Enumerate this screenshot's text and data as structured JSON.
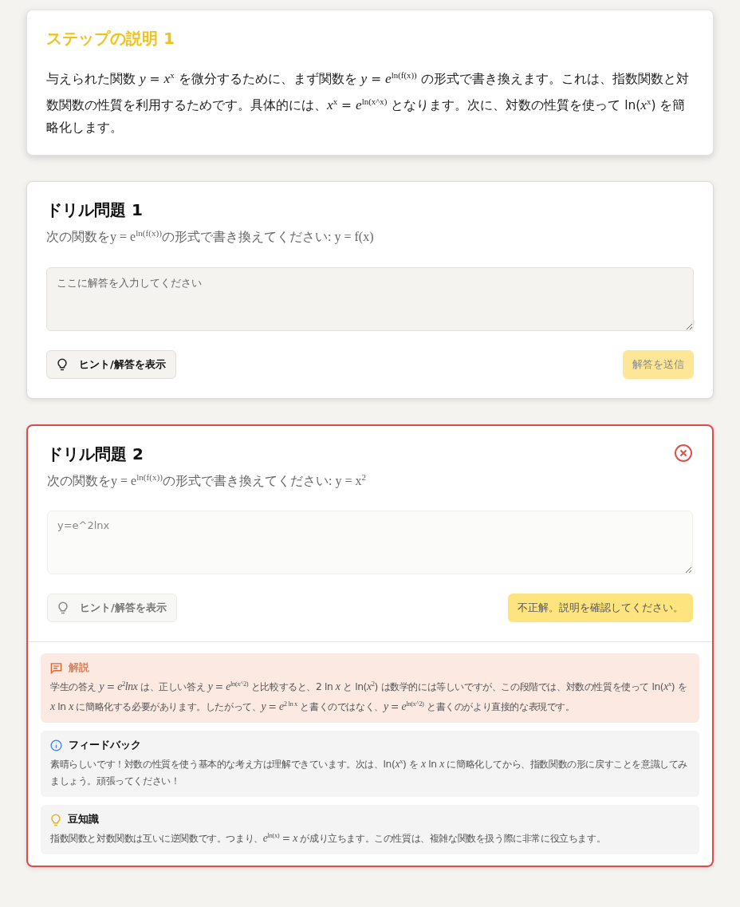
{
  "step": {
    "title": "ステップの説明 1",
    "body": "与えられた関数 *y* = *x*$^{x}$ を微分するために、まず関数を *y* = *e*$^{ln(f(x))}$ の形式で書き換えます。これは、指数関数と対数関数の性質を利用するためです。具体的には、*x*$^{x}$ = *e*$^{ln(x^x)}$ となります。次に、対数の性質を使って ln(*x*$^{x}$) を簡略化します。"
  },
  "drills": [
    {
      "title": "ドリル問題 1",
      "prompt": "次の関数をy = e$^{ln(f(x))}$の形式で書き換えてください: y = f(x)",
      "incorrect": false,
      "answer": {
        "placeholder": "ここに解答を入力してください",
        "disabled": false
      },
      "hint_button": {
        "label": "ヒント/解答を表示",
        "disabled": false
      },
      "submit_button": {
        "label": "解答を送信",
        "disabled": true
      }
    },
    {
      "title": "ドリル問題 2",
      "prompt": "次の関数をy = e$^{ln(f(x))}$の形式で書き換えてください: y = x$^{2}$",
      "incorrect": true,
      "answer": {
        "value": "y=e^2lnx",
        "disabled": true
      },
      "hint_button": {
        "label": "ヒント/解答を表示",
        "disabled": true
      },
      "submit_button": {
        "label": "不正解。説明を確認してください。",
        "disabled": false
      },
      "panels": [
        {
          "kind": "explanation",
          "title": "解説",
          "body": "学生の答え *y* = *e*$^{2}$*lnx* は、正しい答え *y* = *e*$^{ln(x^2)}$ と比較すると、2 ln *x* と ln(*x*$^{2}$) は数学的には等しいですが、この段階では、対数の性質を使って ln(*x*$^{x}$) を *x* ln *x* に簡略化する必要があります。したがって、*y* = *e*$^{2 ln x}$ と書くのではなく、*y* = *e*$^{ln(x^2)}$ と書くのがより直接的な表現です。"
        },
        {
          "kind": "feedback",
          "title": "フィードバック",
          "body": "素晴らしいです！対数の性質を使う基本的な考え方は理解できています。次は、ln(*x*$^{x}$) を *x* ln *x* に簡略化してから、指数関数の形に戻すことを意識してみましょう。頑張ってください！"
        },
        {
          "kind": "trivia",
          "title": "豆知識",
          "body": "指数関数と対数関数は互いに逆関数です。つまり、*e*$^{ln(x)}$ = *x* が成り立ちます。この性質は、複雑な関数を扱う際に非常に役立ちます。"
        }
      ]
    }
  ]
}
